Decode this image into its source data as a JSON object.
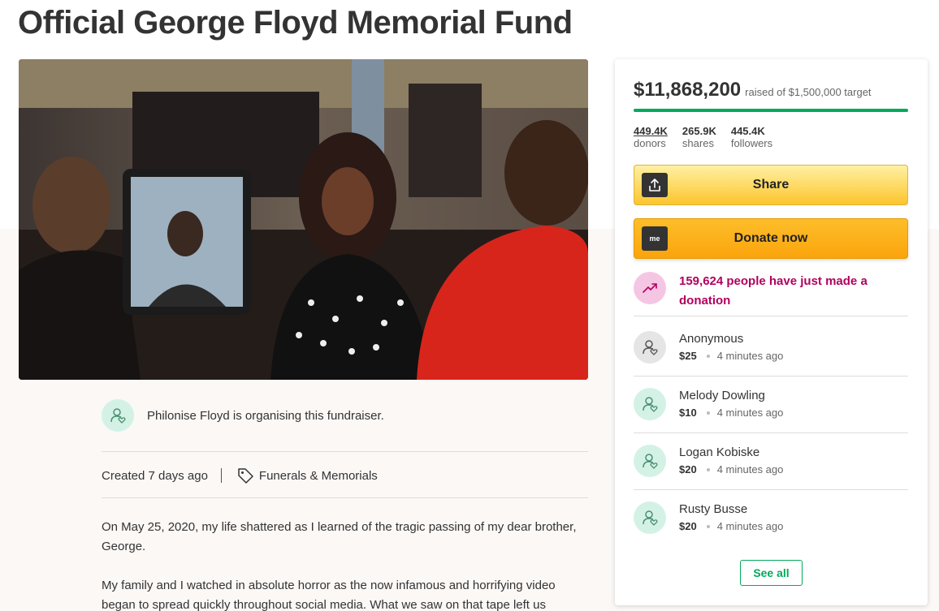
{
  "page": {
    "title": "Official George Floyd Memorial Fund"
  },
  "organiser": {
    "text": "Philonise Floyd is organising this fundraiser."
  },
  "meta": {
    "created": "Created 7 days ago",
    "category": "Funerals & Memorials"
  },
  "story": {
    "paragraphs": [
      "On May 25, 2020, my life shattered as I learned of the tragic passing of my dear brother, George.",
      "My family and I watched in absolute horror as the now infamous and horrifying video began to spread quickly throughout social media. What we saw on that tape left us"
    ]
  },
  "sidebar": {
    "raised_amount": "$11,868,200",
    "raised_target": "raised of $1,500,000 target",
    "progress": 1.0,
    "stats": [
      {
        "value": "449.4K",
        "label": "donors"
      },
      {
        "value": "265.9K",
        "label": "shares"
      },
      {
        "value": "445.4K",
        "label": "followers"
      }
    ],
    "share_label": "Share",
    "donate_label": "Donate now",
    "donate_icon_text": "me",
    "recent_text": "159,624 people have just made a donation",
    "donations": [
      {
        "name": "Anonymous",
        "amount": "$25",
        "time": "4 minutes ago"
      },
      {
        "name": "Melody Dowling",
        "amount": "$10",
        "time": "4 minutes ago"
      },
      {
        "name": "Logan Kobiske",
        "amount": "$20",
        "time": "4 minutes ago"
      },
      {
        "name": "Rusty Busse",
        "amount": "$20",
        "time": "4 minutes ago"
      }
    ],
    "see_all_label": "See all"
  },
  "colors": {
    "accent_green": "#02a95c",
    "recent_pink": "#b1005f",
    "button_yellow": "#fcc52c",
    "button_orange": "#fba40c"
  }
}
